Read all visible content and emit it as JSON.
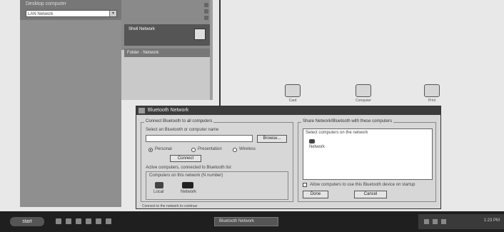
{
  "left_panel": {
    "label": "Desktop computer",
    "combo_value": "LAN Network"
  },
  "mid_panel": {
    "folder_label": "Shell Network",
    "sub_label": "Folder - Network"
  },
  "desktop_icons": [
    {
      "label": "Card",
      "icon": "pc-card-icon"
    },
    {
      "label": "Computer",
      "icon": "computer-icon"
    },
    {
      "label": "Print",
      "icon": "printer-icon"
    }
  ],
  "dialog": {
    "title": "Bluetooth Network",
    "left_group": {
      "title": "Connect Bluetooth to all computers",
      "instruction": "Select an Bluetooth or computer name",
      "browse_label": "Browse...",
      "radios": [
        {
          "label": "Personal",
          "selected": true
        },
        {
          "label": "Presentation",
          "selected": false
        },
        {
          "label": "Wireless",
          "selected": false
        }
      ],
      "connect_label": "Connect",
      "devices_title": "Active computers, connected to Bluetooth list",
      "devices_sub": "Computers on this network (N number)",
      "devices": [
        {
          "label": "Local"
        },
        {
          "label": "Network"
        }
      ]
    },
    "right_group": {
      "title": "Share Network/Bluetooth with these computers",
      "list_title": "Select computers on the network",
      "list_items": [
        "Network"
      ],
      "checkbox_label": "Allow computers to use this Bluetooth device on startup",
      "ok_label": "Done",
      "cancel_label": "Cancel"
    },
    "status": "Connect to the network to continue"
  },
  "taskbar": {
    "start_label": "start",
    "task_label": "Bluetooth Network",
    "clock": "1:23 PM"
  }
}
